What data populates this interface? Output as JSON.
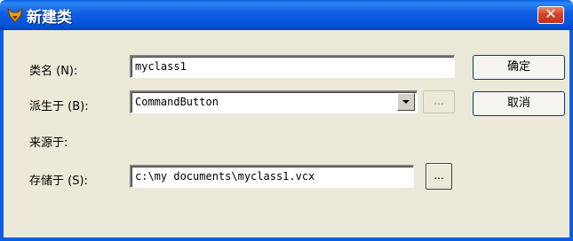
{
  "window": {
    "title": "新建类",
    "close_label": "✕"
  },
  "form": {
    "class_name_label": "类名 (N):",
    "class_name_value": "myclass1",
    "based_on_label": "派生于 (B):",
    "based_on_value": "CommandButton",
    "from_label": "来源于:",
    "store_in_label": "存储于 (S):",
    "store_in_value": "c:\\my documents\\myclass1.vcx",
    "browse_label": "..."
  },
  "buttons": {
    "ok_label": "确定",
    "cancel_label": "取消"
  },
  "colors": {
    "titlebar": "#0A5FE0",
    "dialog_bg": "#ECE9D8",
    "close_red": "#D8412A"
  }
}
